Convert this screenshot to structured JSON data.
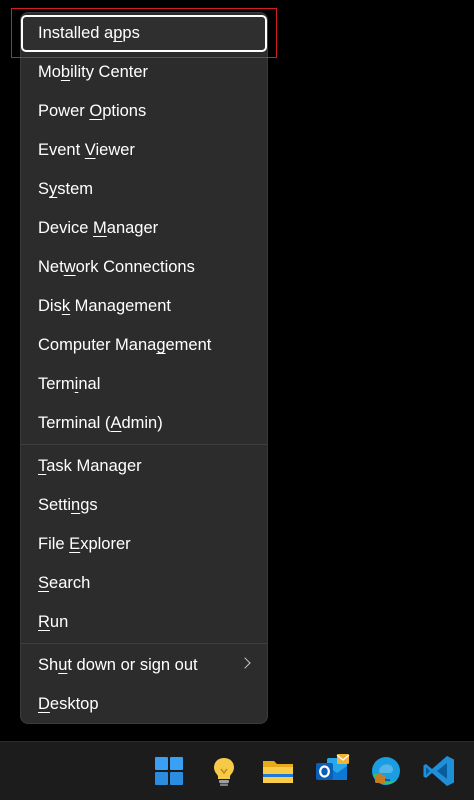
{
  "context_menu": {
    "items": [
      {
        "before": "Installed a",
        "key": "p",
        "after": "ps",
        "focused": true
      },
      {
        "before": "Mo",
        "key": "b",
        "after": "ility Center"
      },
      {
        "before": "Power ",
        "key": "O",
        "after": "ptions"
      },
      {
        "before": "Event ",
        "key": "V",
        "after": "iewer"
      },
      {
        "before": "S",
        "key": "y",
        "after": "stem"
      },
      {
        "before": "Device ",
        "key": "M",
        "after": "anager"
      },
      {
        "before": "Net",
        "key": "w",
        "after": "ork Connections"
      },
      {
        "before": "Dis",
        "key": "k",
        "after": " Management"
      },
      {
        "before": "Computer Mana",
        "key": "g",
        "after": "ement"
      },
      {
        "before": "Term",
        "key": "i",
        "after": "nal"
      },
      {
        "before": "Terminal (",
        "key": "A",
        "after": "dmin)"
      },
      {
        "before": "",
        "key": "T",
        "after": "ask Manager"
      },
      {
        "before": "Setti",
        "key": "n",
        "after": "gs"
      },
      {
        "before": "File ",
        "key": "E",
        "after": "xplorer"
      },
      {
        "before": "",
        "key": "S",
        "after": "earch"
      },
      {
        "before": "",
        "key": "R",
        "after": "un"
      },
      {
        "before": "Sh",
        "key": "u",
        "after": "t down or sign out",
        "submenu": true
      },
      {
        "before": "",
        "key": "D",
        "after": "esktop"
      }
    ]
  },
  "taskbar": {
    "icons": [
      "windows-start-icon",
      "tips-lightbulb-icon",
      "file-explorer-icon",
      "outlook-icon",
      "edge-icon",
      "vscode-icon"
    ]
  },
  "colors": {
    "menu_bg": "#2c2c2c",
    "taskbar_bg": "#1c1c1c",
    "highlight": "#d11f1f",
    "text": "#ffffff"
  }
}
